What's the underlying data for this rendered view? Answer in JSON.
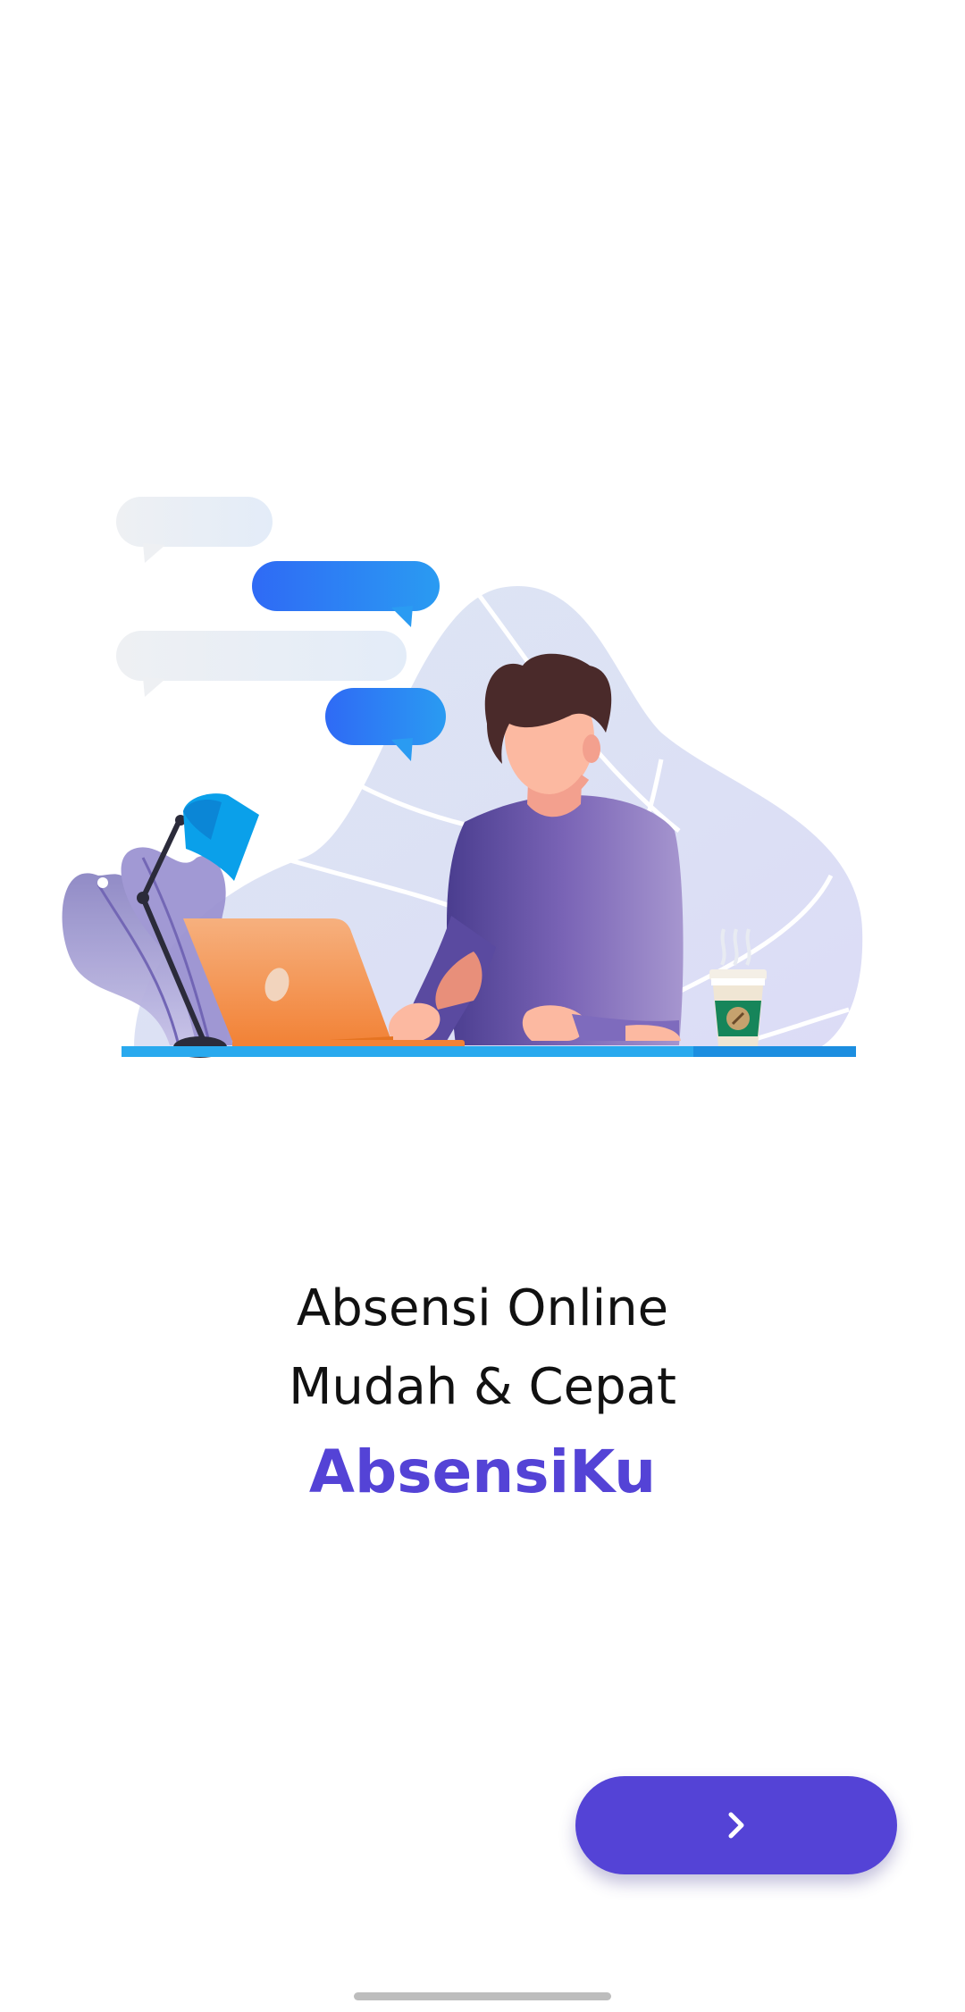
{
  "onboarding": {
    "tagline_line1": "Absensi Online",
    "tagline_line2": "Mudah & Cepat",
    "brand_name": "AbsensiKu",
    "next_button_icon": "chevron-right-icon",
    "illustration": "person-working-at-laptop-illustration"
  },
  "colors": {
    "accent": "#5443d6",
    "text": "#111111",
    "background": "#ffffff",
    "home_indicator": "#bdbdbd"
  }
}
